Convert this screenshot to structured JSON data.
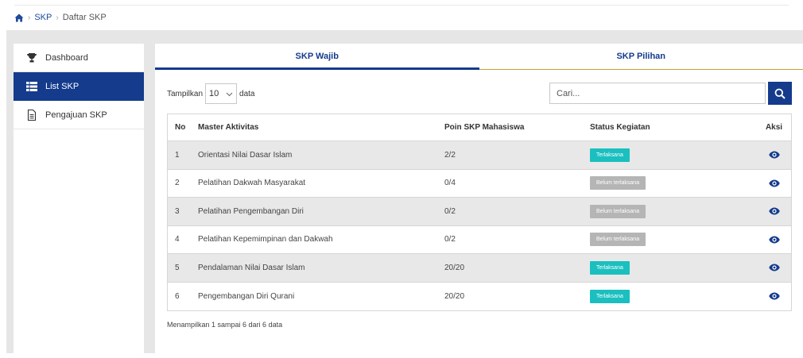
{
  "breadcrumb": {
    "home_icon": "home-icon",
    "items": [
      "SKP",
      "Daftar SKP"
    ]
  },
  "sidebar": {
    "items": [
      {
        "label": "Dashboard",
        "icon": "trophy-icon",
        "active": false
      },
      {
        "label": "List SKP",
        "icon": "list-icon",
        "active": true
      },
      {
        "label": "Pengajuan SKP",
        "icon": "document-icon",
        "active": false
      }
    ]
  },
  "tabs": [
    {
      "label": "SKP Wajib",
      "active": true
    },
    {
      "label": "SKP Pilihan",
      "active": false
    }
  ],
  "controls": {
    "show_prefix": "Tampilkan",
    "show_value": "10",
    "show_suffix": "data",
    "search_placeholder": "Cari..."
  },
  "table": {
    "headers": [
      "No",
      "Master Aktivitas",
      "Poin SKP Mahasiswa",
      "Status Kegiatan",
      "Aksi"
    ],
    "rows": [
      {
        "no": "1",
        "name": "Orientasi Nilai Dasar Islam",
        "poin": "2/2",
        "status": "Terlaksana",
        "done": true
      },
      {
        "no": "2",
        "name": "Pelatihan Dakwah Masyarakat",
        "poin": "0/4",
        "status": "Belum terlaksana",
        "done": false
      },
      {
        "no": "3",
        "name": "Pelatihan Pengembangan Diri",
        "poin": "0/2",
        "status": "Belum terlaksana",
        "done": false
      },
      {
        "no": "4",
        "name": "Pelatihan Kepemimpinan dan Dakwah",
        "poin": "0/2",
        "status": "Belum terlaksana",
        "done": false
      },
      {
        "no": "5",
        "name": "Pendalaman Nilai Dasar Islam",
        "poin": "20/20",
        "status": "Terlaksana",
        "done": true
      },
      {
        "no": "6",
        "name": "Pengembangan Diri Qurani",
        "poin": "20/20",
        "status": "Terlaksana",
        "done": true
      }
    ]
  },
  "info": "Menampilkan 1 sampai 6 dari 6 data",
  "colors": {
    "primary": "#143b8c",
    "accent": "#c9a227",
    "done": "#1bbfbf",
    "pending": "#b5b5b5"
  }
}
